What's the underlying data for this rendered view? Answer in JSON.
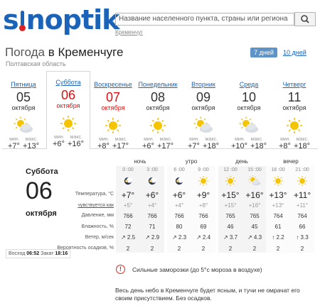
{
  "header": {
    "logo": "sinoptik",
    "search_placeholder": "Название населенного пункта, страны или региона",
    "city_link": "Кременчуг"
  },
  "page": {
    "title_prefix": "Погода",
    "title_city": "в Кременчуге",
    "region": "Полтавская область",
    "tab_7": "7 дней",
    "tab_10": "10 дней"
  },
  "days": [
    {
      "name": "Пятница",
      "date": "05",
      "month": "октября",
      "min_label": "мин.",
      "max_label": "макс.",
      "min": "+7°",
      "max": "+13°",
      "icon": "partly-cloudy-icon",
      "red": false
    },
    {
      "name": "Суббота",
      "date": "06",
      "month": "октября",
      "min_label": "мин.",
      "max_label": "макс.",
      "min": "+6°",
      "max": "+16°",
      "icon": "sun-icon",
      "red": true
    },
    {
      "name": "Воскресенье",
      "date": "07",
      "month": "октября",
      "min_label": "мин.",
      "max_label": "макс.",
      "min": "+8°",
      "max": "+17°",
      "icon": "sun-icon",
      "red": true
    },
    {
      "name": "Понедельник",
      "date": "08",
      "month": "октября",
      "min_label": "мин.",
      "max_label": "макс.",
      "min": "+6°",
      "max": "+17°",
      "icon": "sun-icon",
      "red": false
    },
    {
      "name": "Вторник",
      "date": "09",
      "month": "октября",
      "min_label": "мин.",
      "max_label": "макс.",
      "min": "+7°",
      "max": "+18°",
      "icon": "partly-cloudy-icon",
      "red": false
    },
    {
      "name": "Среда",
      "date": "10",
      "month": "октября",
      "min_label": "мин.",
      "max_label": "макс.",
      "min": "+10°",
      "max": "+18°",
      "icon": "partly-cloudy-icon",
      "red": false
    },
    {
      "name": "Четверг",
      "date": "11",
      "month": "октября",
      "min_label": "мин.",
      "max_label": "макс.",
      "min": "+8°",
      "max": "+18°",
      "icon": "sun-icon",
      "red": false
    }
  ],
  "detail": {
    "day_name": "Суббота",
    "date": "06",
    "month": "октября",
    "sunrise_label": "Восход",
    "sunrise": "06:52",
    "sunset_label": "Закат",
    "sunset": "18:16",
    "groups": [
      "ночь",
      "утро",
      "день",
      "вечер"
    ],
    "times": [
      "0 :00",
      "3 :00",
      "6 :00",
      "9 :00",
      "12 :00",
      "15 :00",
      "18 :00",
      "21 :00"
    ],
    "row_labels": [
      "Температура, °С",
      "чувствуется как",
      "Давление, мм",
      "Влажность, %",
      "Ветер, м/сек",
      "Вероятность осадков, %"
    ],
    "icons": [
      "clear-night-icon",
      "clear-night-icon",
      "clear-night-icon",
      "sun-icon",
      "sun-icon",
      "partly-cloudy-icon",
      "sun-icon",
      "sun-icon"
    ],
    "temperature": [
      "+7°",
      "+6°",
      "+6°",
      "+9°",
      "+15°",
      "+16°",
      "+13°",
      "+11°"
    ],
    "feels_like": [
      "+5°",
      "+4°",
      "+4°",
      "+8°",
      "+15°",
      "+16°",
      "+13°",
      "+11°"
    ],
    "pressure": [
      "766",
      "766",
      "766",
      "766",
      "765",
      "765",
      "764",
      "764"
    ],
    "humidity": [
      "72",
      "71",
      "80",
      "69",
      "46",
      "45",
      "61",
      "66"
    ],
    "wind": [
      "2.5",
      "2.9",
      "2.3",
      "2.4",
      "3.7",
      "4.3",
      "2.2",
      "3.3"
    ],
    "wind_arrows": [
      "↗",
      "↗",
      "↗",
      "↗",
      "↗",
      "↗",
      "↑",
      "↑"
    ],
    "precipitation": [
      "2",
      "2",
      "2",
      "2",
      "2",
      "2",
      "2",
      "2"
    ],
    "warning": "Сильные заморозки (до 5°с мороза в воздухе)",
    "description": "Весь день небо в Кременчуге будет ясным, и тучи не омрачат его своим присутствием. Без осадков."
  },
  "colors": {
    "brand": "#1a63b8",
    "red": "#d11",
    "tab_active": "#5e93c8",
    "sun": "#f5b800"
  }
}
